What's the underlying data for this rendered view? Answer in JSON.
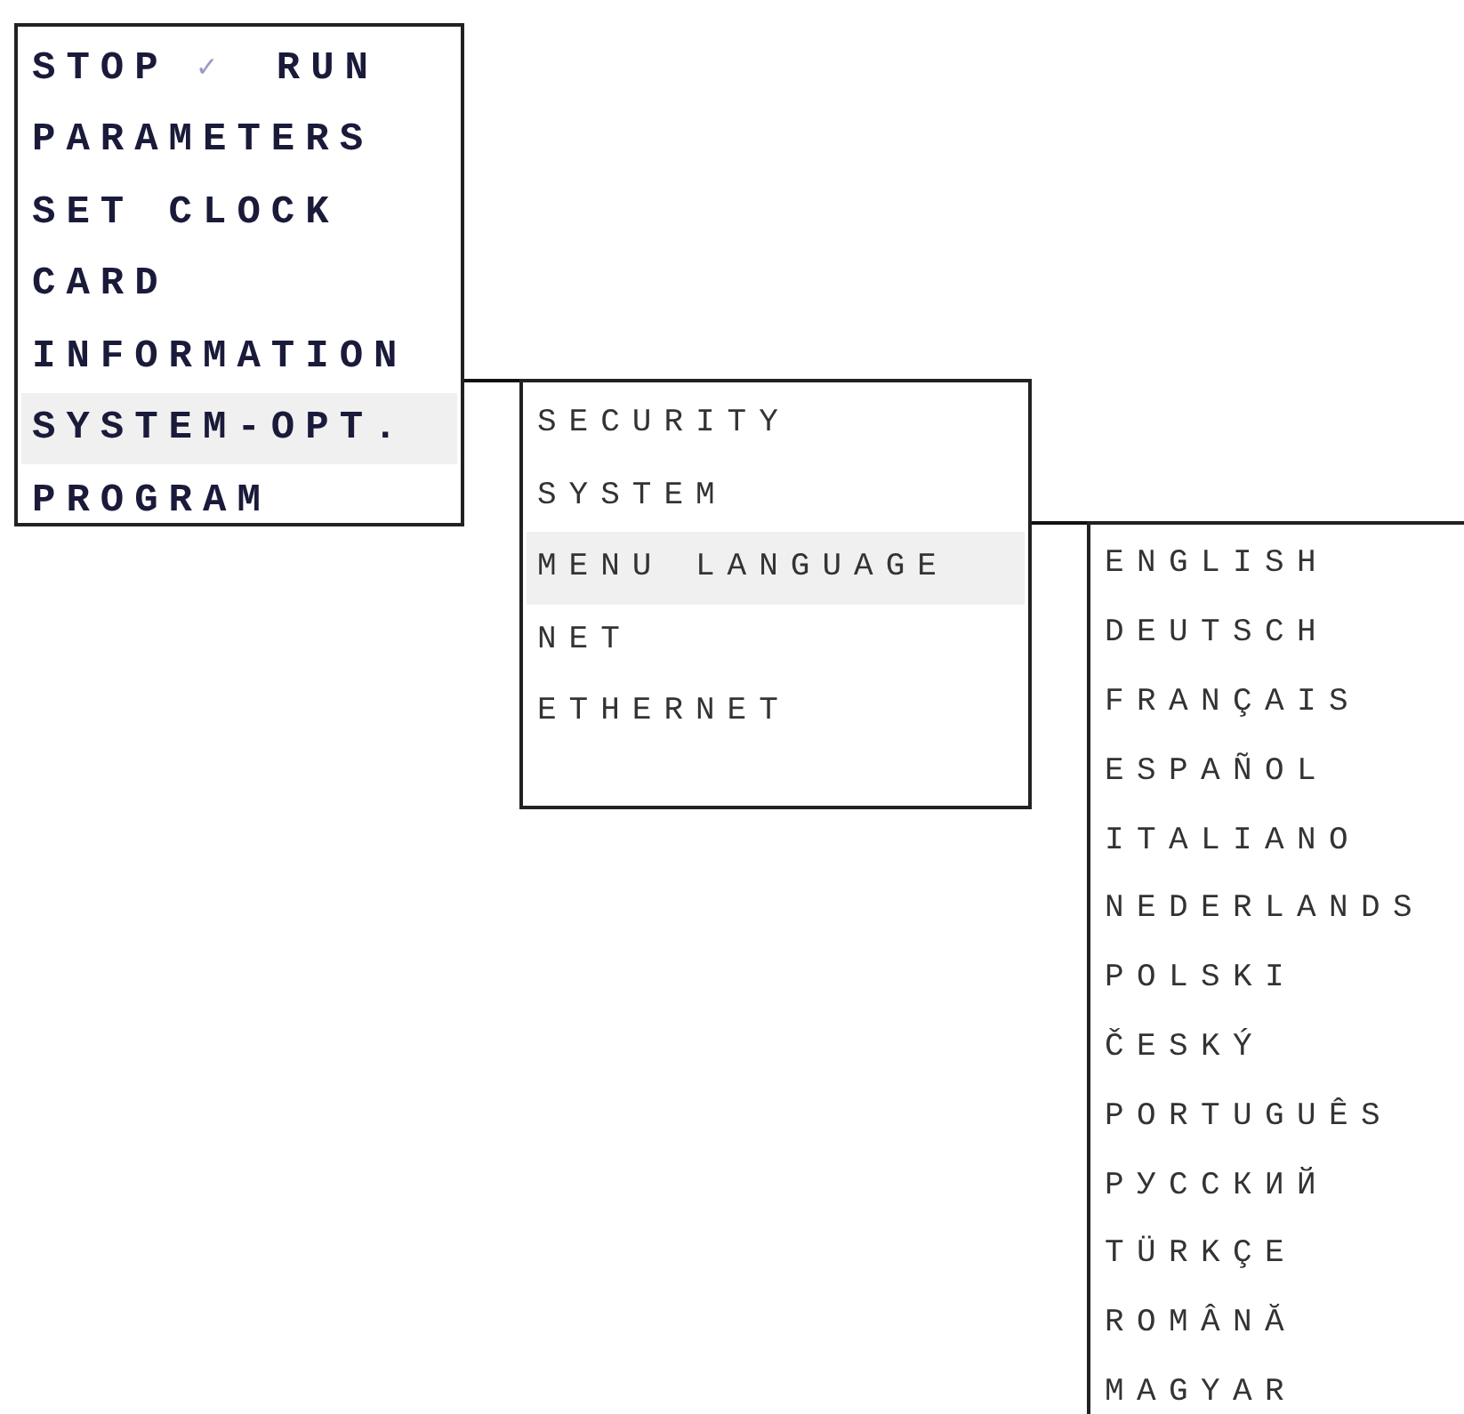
{
  "menus": [
    {
      "items": [
        {
          "kind": "toggle",
          "left": "STOP",
          "mark": "✓",
          "right": "RUN"
        },
        {
          "kind": "entry",
          "label": "PARAMETERS",
          "selected": false
        },
        {
          "kind": "entry",
          "label": "SET CLOCK",
          "selected": false
        },
        {
          "kind": "entry",
          "label": "CARD",
          "selected": false
        },
        {
          "kind": "entry",
          "label": "INFORMATION",
          "selected": false
        },
        {
          "kind": "entry",
          "label": "SYSTEM-OPT.",
          "selected": true
        },
        {
          "kind": "entry",
          "label": "PROGRAM",
          "selected": false
        }
      ]
    },
    {
      "items": [
        {
          "kind": "entry",
          "label": "SECURITY",
          "selected": false
        },
        {
          "kind": "entry",
          "label": "SYSTEM",
          "selected": false
        },
        {
          "kind": "entry",
          "label": "MENU LANGUAGE",
          "selected": true
        },
        {
          "kind": "entry",
          "label": "NET",
          "selected": false
        },
        {
          "kind": "entry",
          "label": "ETHERNET",
          "selected": false
        }
      ]
    },
    {
      "items": [
        {
          "kind": "entry",
          "label": "ENGLISH",
          "selected": false
        },
        {
          "kind": "entry",
          "label": "DEUTSCH",
          "selected": false
        },
        {
          "kind": "entry",
          "label": "FRANÇAIS",
          "selected": false
        },
        {
          "kind": "entry",
          "label": "ESPAÑOL",
          "selected": false
        },
        {
          "kind": "entry",
          "label": "ITALIANO",
          "selected": false
        },
        {
          "kind": "entry",
          "label": "NEDERLANDS",
          "selected": false
        },
        {
          "kind": "entry",
          "label": "POLSKI",
          "selected": false
        },
        {
          "kind": "entry",
          "label": "ČESKÝ",
          "selected": false
        },
        {
          "kind": "entry",
          "label": "PORTUGUÊS",
          "selected": false
        },
        {
          "kind": "entry",
          "label": "РУССКИЙ",
          "selected": false
        },
        {
          "kind": "entry",
          "label": "TÜRKÇE",
          "selected": false
        },
        {
          "kind": "entry",
          "label": "ROMÂNĂ",
          "selected": false
        },
        {
          "kind": "entry",
          "label": "MAGYAR",
          "selected": false
        }
      ]
    }
  ]
}
